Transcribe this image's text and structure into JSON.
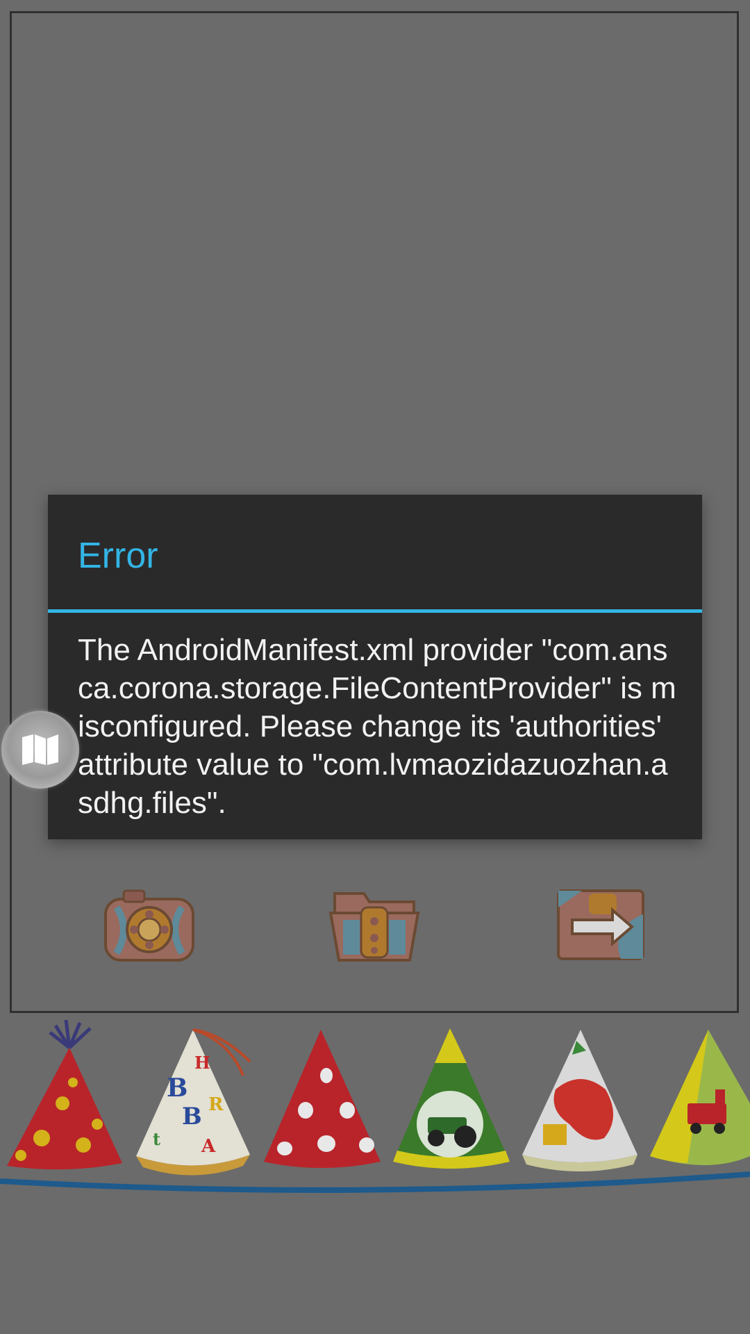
{
  "dialog": {
    "title": "Error",
    "message": "The AndroidManifest.xml provider \"com.ansca.corona.storage.FileContentProvider\" is misconfigured. Please change its 'authorities' attribute value to \"com.lvmaozidazuozhan.asdhg.files\"."
  },
  "toolbar": {
    "camera_icon": "camera-icon",
    "folder_icon": "folder-icon",
    "share_icon": "share-icon"
  },
  "floating_button": {
    "icon": "map-icon"
  },
  "colors": {
    "accent": "#33b5e5",
    "dialog_bg": "#2a2a2a",
    "overlay_bg": "#6b6b6b",
    "shelf_line": "#1e5a8c"
  }
}
